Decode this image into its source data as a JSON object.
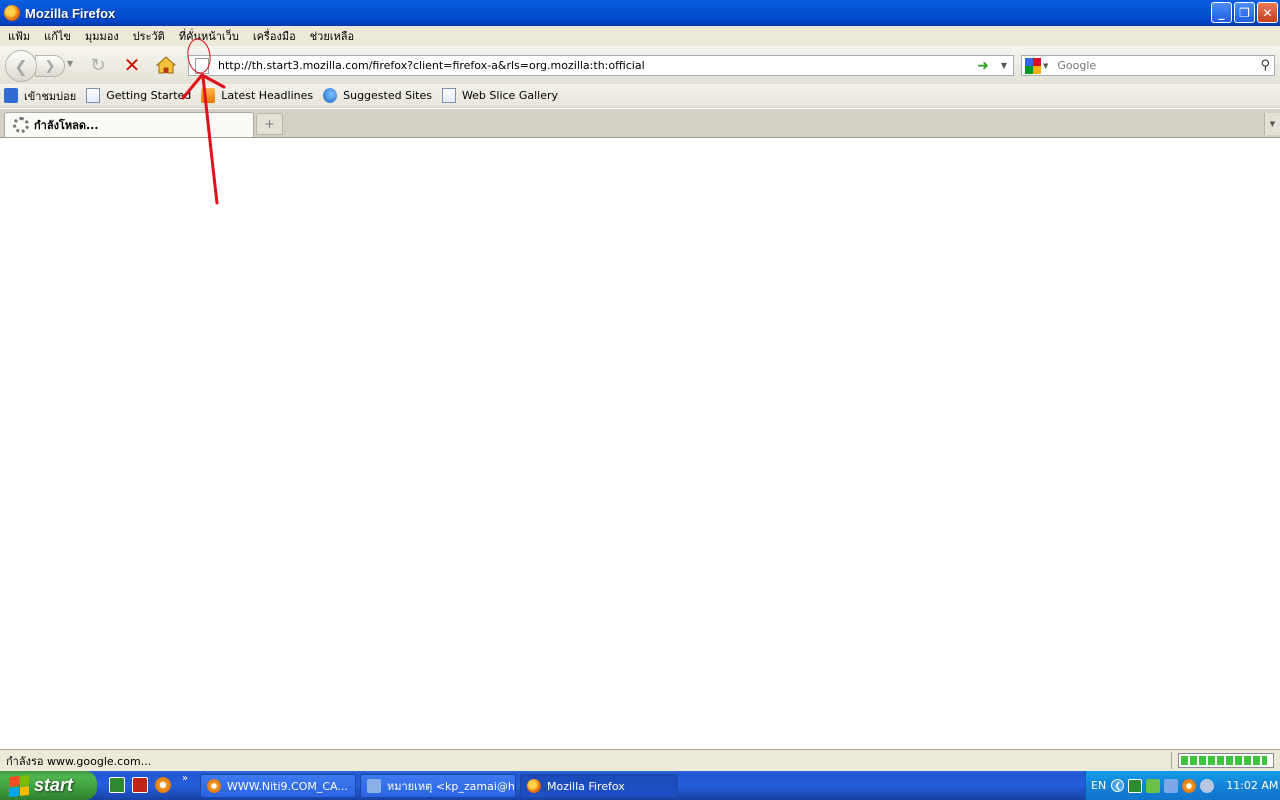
{
  "window": {
    "title": "Mozilla Firefox"
  },
  "menu": [
    "แฟ้ม",
    "แก้ไข",
    "มุมมอง",
    "ประวัติ",
    "ที่คั่นหน้าเว็บ",
    "เครื่องมือ",
    "ช่วยเหลือ"
  ],
  "navigation": {
    "url": "http://th.start3.mozilla.com/firefox?client=firefox-a&rls=org.mozilla:th:official",
    "search_placeholder": "Google"
  },
  "bookmarks": [
    {
      "label": "เข้าชมบ่อย",
      "icon": "most-visited-icon"
    },
    {
      "label": "Getting Started",
      "icon": "page-icon"
    },
    {
      "label": "Latest Headlines",
      "icon": "rss-feed-icon"
    },
    {
      "label": "Suggested Sites",
      "icon": "ie-icon"
    },
    {
      "label": "Web Slice Gallery",
      "icon": "page-icon"
    }
  ],
  "tabs": [
    {
      "label": "กำลังโหลด...",
      "loading": true
    }
  ],
  "status": {
    "text": "กำลังรอ www.google.com...",
    "progress": 0.95
  },
  "taskbar": {
    "start_label": "start",
    "tasks": [
      {
        "label": "WWW.Niti9.COM_CA...",
        "active": false
      },
      {
        "label": "หมายเหตุ <kp_zamai@h...",
        "active": false
      },
      {
        "label": "Mozilla Firefox",
        "active": true
      }
    ],
    "language": "EN",
    "clock": "11:02 AM"
  },
  "colors": {
    "annotation": "#e0101a",
    "titlebar": "#0552d2",
    "taskbar": "#245edb"
  }
}
